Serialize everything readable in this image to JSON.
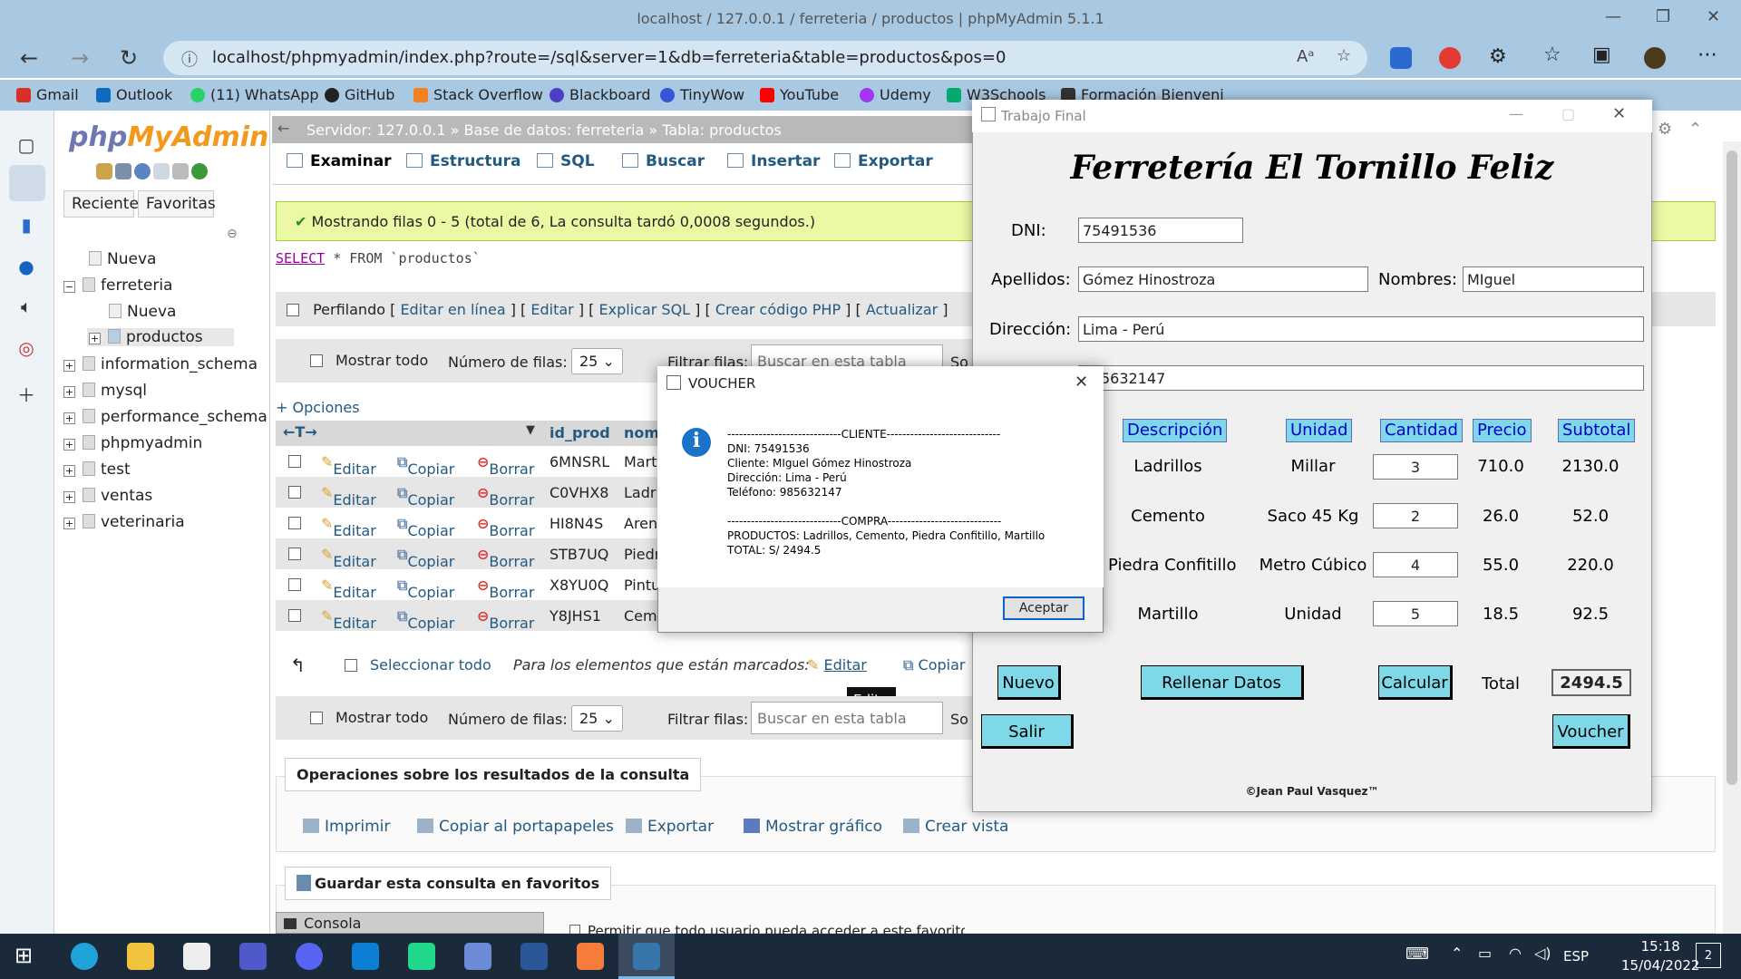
{
  "browser": {
    "title": "localhost / 127.0.0.1 / ferreteria / productos | phpMyAdmin 5.1.1",
    "url": "localhost/phpmyadmin/index.php?route=/sql&server=1&db=ferreteria&table=productos&pos=0",
    "bookmarks": [
      {
        "label": "Gmail",
        "color": "#d93025"
      },
      {
        "label": "Outlook",
        "color": "#0f6cbd"
      },
      {
        "label": "(11) WhatsApp",
        "color": "#25d366"
      },
      {
        "label": "GitHub",
        "color": "#222222"
      },
      {
        "label": "Stack Overflow",
        "color": "#f48024"
      },
      {
        "label": "Blackboard",
        "color": "#4b3fc8"
      },
      {
        "label": "TinyWow",
        "color": "#3656d6"
      },
      {
        "label": "YouTube",
        "color": "#ff0000"
      },
      {
        "label": "Udemy",
        "color": "#a435f0"
      },
      {
        "label": "W3Schools",
        "color": "#04aa6d"
      },
      {
        "label": "Formación Bienveni",
        "color": "#333333"
      }
    ]
  },
  "pma": {
    "logo_a": "php",
    "logo_b": "MyAdmin",
    "side_tabs": [
      "Reciente",
      "Favoritas"
    ],
    "tree": [
      {
        "label": "Nueva",
        "level": 0
      },
      {
        "label": "ferreteria",
        "level": 0
      },
      {
        "label": "Nueva",
        "level": 1
      },
      {
        "label": "productos",
        "level": 1
      },
      {
        "label": "information_schema",
        "level": 0
      },
      {
        "label": "mysql",
        "level": 0
      },
      {
        "label": "performance_schema",
        "level": 0
      },
      {
        "label": "phpmyadmin",
        "level": 0
      },
      {
        "label": "test",
        "level": 0
      },
      {
        "label": "ventas",
        "level": 0
      },
      {
        "label": "veterinaria",
        "level": 0
      }
    ],
    "breadcrumb": {
      "server": "Servidor: 127.0.0.1",
      "db": "Base de datos: ferreteria",
      "table": "Tabla: productos"
    },
    "tabs": [
      "Examinar",
      "Estructura",
      "SQL",
      "Buscar",
      "Insertar",
      "Exportar"
    ],
    "success": "Mostrando filas 0 - 5 (total de 6, La consulta tardó 0,0008 segundos.)",
    "sql_kw": "SELECT",
    "sql_rest": "* FROM `productos`",
    "profiling": {
      "label": "Perfilando",
      "links": [
        "Editar en línea",
        "Editar",
        "Explicar SQL",
        "Crear código PHP",
        "Actualizar"
      ]
    },
    "controls": {
      "show_all": "Mostrar todo",
      "rows_label": "Número de filas:",
      "rows_value": "25",
      "filter_label": "Filtrar filas:",
      "filter_placeholder": "Buscar en esta tabla",
      "sort": "So"
    },
    "options": "+ Opciones",
    "columns": [
      "id_prod",
      "nom"
    ],
    "row_actions": {
      "edit": "Editar",
      "copy": "Copiar",
      "delete": "Borrar"
    },
    "rows": [
      {
        "id": "6MNSRL",
        "name": "Marti"
      },
      {
        "id": "C0VHX8",
        "name": "Ladri"
      },
      {
        "id": "HI8N4S",
        "name": "Arena"
      },
      {
        "id": "STB7UQ",
        "name": "Piedr"
      },
      {
        "id": "X8YU0Q",
        "name": "Pintu"
      },
      {
        "id": "Y8JHS1",
        "name": "Cem"
      }
    ],
    "bulk": {
      "select_all": "Seleccionar todo",
      "marked": "Para los elementos que están marcados:",
      "edit": "Editar",
      "copy": "Copiar"
    },
    "tooltip": "Editar",
    "ops_title": "Operaciones sobre los resultados de la consulta",
    "ops": [
      "Imprimir",
      "Copiar al portapapeles",
      "Exportar",
      "Mostrar gráfico",
      "Crear vista"
    ],
    "bookmark_title": "Guardar esta consulta en favoritos",
    "permit": "Permitir que todo usuario pueda acceder a este favorito",
    "console": "Consola"
  },
  "app": {
    "window_title": "Trabajo Final",
    "heading": "Ferretería El Tornillo Feliz",
    "labels": {
      "dni": "DNI:",
      "apellidos": "Apellidos:",
      "nombres": "Nombres:",
      "direccion": "Dirección:"
    },
    "values": {
      "dni": "75491536",
      "apellidos": "Gómez Hinostroza",
      "nombres": "MIguel",
      "direccion": "Lima - Perú",
      "telefono_partial": "5632147"
    },
    "headers": [
      "Descripción",
      "Unidad",
      "Cantidad",
      "Precio",
      "Subtotal"
    ],
    "items": [
      {
        "desc": "Ladrillos",
        "unit": "Millar",
        "qty": "3",
        "price": "710.0",
        "subtotal": "2130.0"
      },
      {
        "desc": "Cemento",
        "unit": "Saco 45 Kg",
        "qty": "2",
        "price": "26.0",
        "subtotal": "52.0"
      },
      {
        "desc": "Piedra Confitillo",
        "unit": "Metro Cúbico",
        "qty": "4",
        "price": "55.0",
        "subtotal": "220.0"
      },
      {
        "desc": "Martillo",
        "unit": "Unidad",
        "qty": "5",
        "price": "18.5",
        "subtotal": "92.5"
      }
    ],
    "buttons": {
      "nuevo": "Nuevo",
      "rellenar": "Rellenar Datos",
      "calcular": "Calcular",
      "salir": "Salir",
      "voucher": "Voucher"
    },
    "total_label": "Total",
    "total_value": "2494.5",
    "credit": "©Jean Paul Vasquez™"
  },
  "voucher": {
    "title": "VOUCHER",
    "lines": [
      "-----------------------------CLIENTE-----------------------------",
      "DNI: 75491536",
      "Cliente: MIguel Gómez Hinostroza",
      "Dirección: Lima - Perú",
      "Teléfono: 985632147",
      "",
      "-----------------------------COMPRA-----------------------------",
      "PRODUCTOS: Ladrillos, Cemento, Piedra Confitillo, Martillo",
      "TOTAL: S/ 2494.5"
    ],
    "ok": "Aceptar"
  },
  "taskbar": {
    "lang": "ESP",
    "time": "15:18",
    "date": "15/04/2022",
    "notif": "2"
  }
}
